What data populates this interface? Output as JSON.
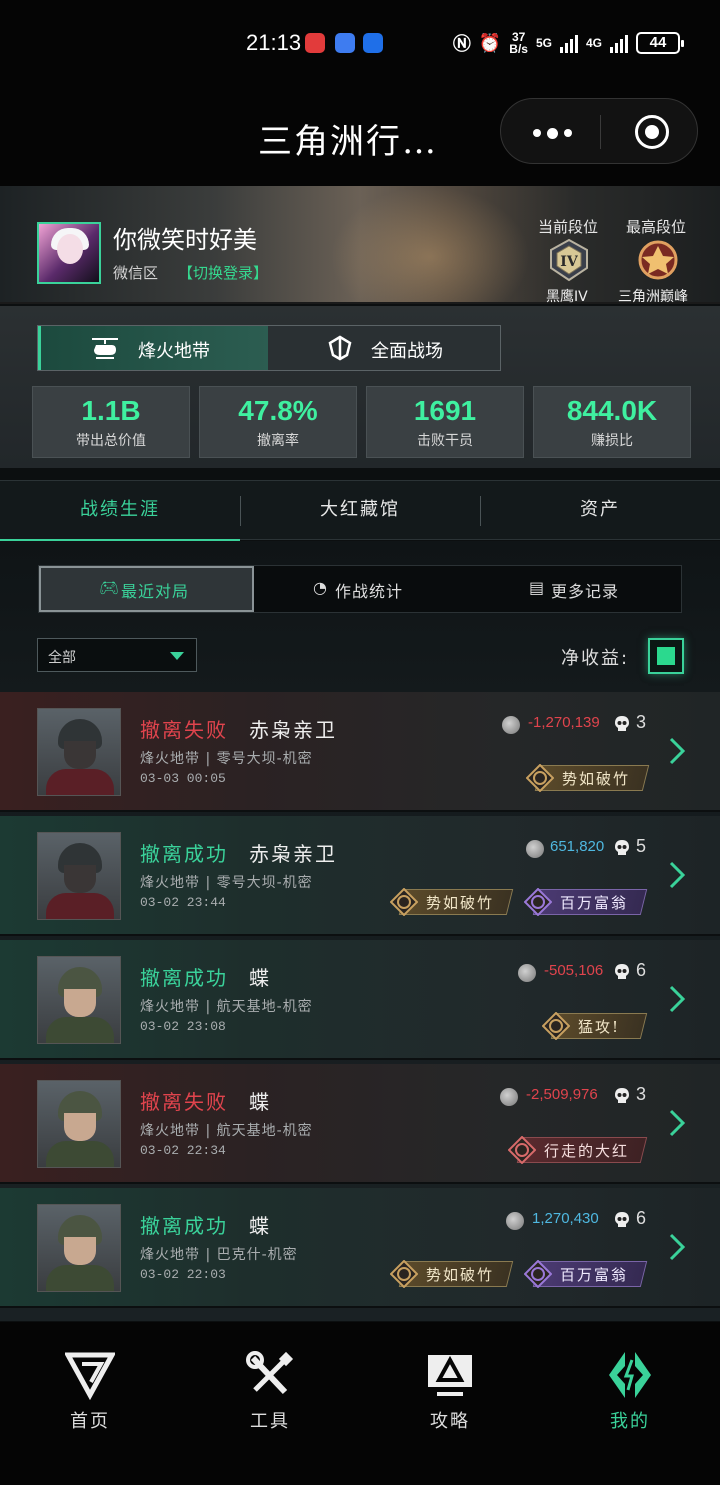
{
  "status_bar": {
    "time": "21:13",
    "net_speed_top": "37",
    "net_speed_unit": "B/s",
    "net1": "5G",
    "net2": "4G",
    "battery": "44"
  },
  "title_bar": {
    "title": "三角洲行…"
  },
  "profile": {
    "nickname": "你微笑时好美",
    "region": "微信区",
    "switch_login": "【切换登录】",
    "current_rank_label": "当前段位",
    "current_rank_name": "黑鹰IV",
    "current_rank_numeral": "IV",
    "highest_rank_label": "最高段位",
    "highest_rank_name": "三角洲巅峰"
  },
  "modes": [
    {
      "label": "烽火地带",
      "active": true
    },
    {
      "label": "全面战场",
      "active": false
    }
  ],
  "stats": [
    {
      "value": "1.1B",
      "label": "带出总价值"
    },
    {
      "value": "47.8%",
      "label": "撤离率"
    },
    {
      "value": "1691",
      "label": "击败干员"
    },
    {
      "value": "844.0K",
      "label": "赚损比"
    }
  ],
  "tabs": [
    {
      "label": "战绩生涯",
      "active": true
    },
    {
      "label": "大红藏馆",
      "active": false
    },
    {
      "label": "资产",
      "active": false
    }
  ],
  "subtabs": [
    {
      "label": "最近对局",
      "active": true
    },
    {
      "label": "作战统计",
      "active": false
    },
    {
      "label": "更多记录",
      "active": false
    }
  ],
  "filter": {
    "value": "全部"
  },
  "net_income_label": "净收益:",
  "matches": [
    {
      "status": "撤离失败",
      "result": "fail",
      "operator": "赤枭亲卫",
      "map": "烽火地带 | 零号大坝-机密",
      "time": "03-03 00:05",
      "value": "-1,270,139",
      "kills": "3",
      "badges": [
        {
          "text": "势如破竹",
          "style": "gold"
        }
      ]
    },
    {
      "status": "撤离成功",
      "result": "ok",
      "operator": "赤枭亲卫",
      "map": "烽火地带 | 零号大坝-机密",
      "time": "03-02 23:44",
      "value": "651,820",
      "kills": "5",
      "badges": [
        {
          "text": "势如破竹",
          "style": "gold"
        },
        {
          "text": "百万富翁",
          "style": "purple"
        }
      ]
    },
    {
      "status": "撤离成功",
      "result": "ok",
      "operator": "蝶",
      "map": "烽火地带 | 航天基地-机密",
      "time": "03-02 23:08",
      "value": "-505,106",
      "kills": "6",
      "badges": [
        {
          "text": "猛攻!",
          "style": "gold"
        }
      ]
    },
    {
      "status": "撤离失败",
      "result": "fail",
      "operator": "蝶",
      "map": "烽火地带 | 航天基地-机密",
      "time": "03-02 22:34",
      "value": "-2,509,976",
      "kills": "3",
      "badges": [
        {
          "text": "行走的大红",
          "style": "red"
        }
      ]
    },
    {
      "status": "撤离成功",
      "result": "ok",
      "operator": "蝶",
      "map": "烽火地带 | 巴克什-机密",
      "time": "03-02 22:03",
      "value": "1,270,430",
      "kills": "6",
      "badges": [
        {
          "text": "势如破竹",
          "style": "gold"
        },
        {
          "text": "百万富翁",
          "style": "purple"
        }
      ]
    }
  ],
  "bottom_nav": [
    {
      "label": "首页",
      "icon": "home-logo-icon",
      "active": false
    },
    {
      "label": "工具",
      "icon": "tools-icon",
      "active": false
    },
    {
      "label": "攻略",
      "icon": "guide-monitor-icon",
      "active": false
    },
    {
      "label": "我的",
      "icon": "profile-logo-icon",
      "active": true
    }
  ],
  "colors": {
    "accent": "#3ad29a",
    "fail": "#e0444d",
    "positive_value": "#4fb8e0"
  }
}
